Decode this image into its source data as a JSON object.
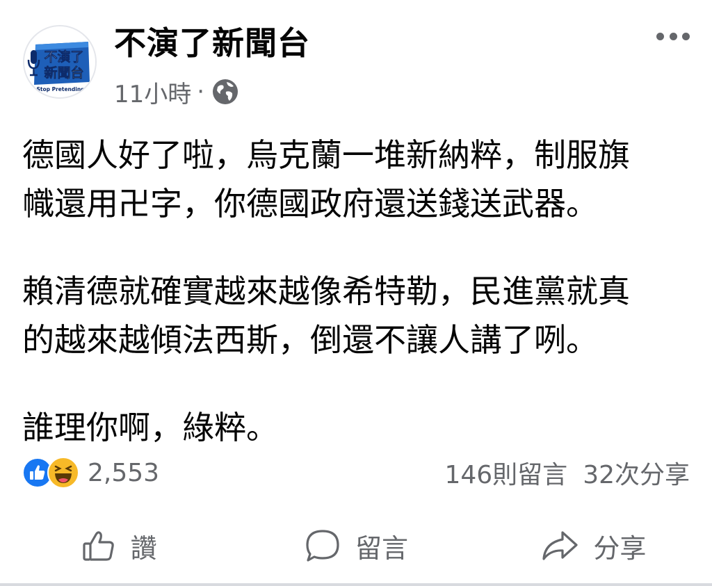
{
  "post": {
    "page_name": "不演了新聞台",
    "timestamp": "11小時",
    "separator": "·",
    "privacy_icon": "globe-icon",
    "avatar": {
      "logo_line1": "不演了",
      "logo_line2": "新聞台",
      "tagline": "Stop Pretending",
      "icon": "microphone-icon"
    },
    "more_icon": "more-dots-icon",
    "paragraphs": [
      [
        "德國人好了啦，烏克蘭一堆新納粹，制服旗",
        "幟還用卍字，你德國政府還送錢送武器。"
      ],
      [
        "賴清德就確實越來越像希特勒，民進黨就真",
        "的越來越傾法西斯，倒還不讓人講了咧。"
      ],
      [
        "誰理你啊，綠粹。"
      ]
    ]
  },
  "stats": {
    "reaction_count": "2,553",
    "reaction_icons": [
      "like-icon",
      "haha-icon"
    ],
    "comments": "146則留言",
    "shares": "32次分享"
  },
  "actions": {
    "like_label": "讚",
    "comment_label": "留言",
    "share_label": "分享"
  },
  "colors": {
    "text_primary": "#050505",
    "text_secondary": "#65676b",
    "like_blue": "#1877f2",
    "haha_yellow": "#f7b928",
    "logo_blue": "#1e5fb8"
  }
}
